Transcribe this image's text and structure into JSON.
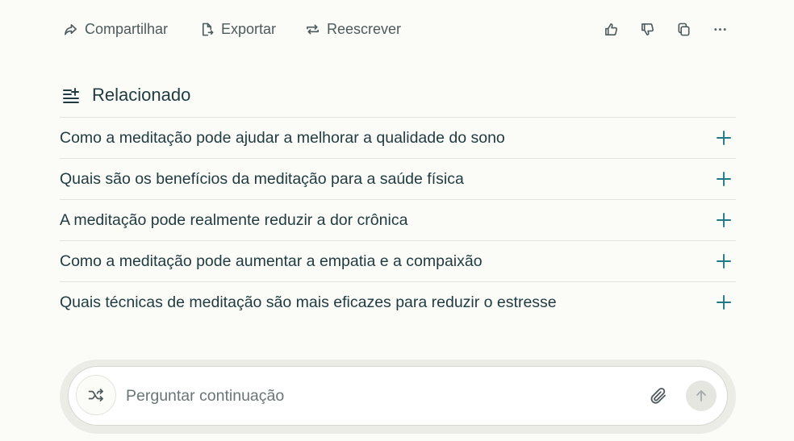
{
  "toolbar": {
    "share_label": "Compartilhar",
    "export_label": "Exportar",
    "rewrite_label": "Reescrever",
    "icons": [
      "share-icon",
      "export-icon",
      "rewrite-icon",
      "thumbs-up-icon",
      "thumbs-down-icon",
      "copy-icon",
      "more-icon"
    ]
  },
  "related": {
    "title": "Relacionado",
    "icon": "related-list-icon",
    "items": [
      {
        "label": "Como a meditação pode ajudar a melhorar a qualidade do sono"
      },
      {
        "label": "Quais são os benefícios da meditação para a saúde física"
      },
      {
        "label": "A meditação pode realmente reduzir a dor crônica"
      },
      {
        "label": "Como a meditação pode aumentar a empatia e a compaixão"
      },
      {
        "label": "Quais técnicas de meditação são mais eficazes para reduzir o estresse"
      }
    ]
  },
  "composer": {
    "placeholder": "Perguntar continuação",
    "value": "",
    "icons": [
      "shuffle-icon",
      "paperclip-icon",
      "arrow-up-icon"
    ]
  },
  "colors": {
    "background": "#fbfbf8",
    "text": "#1f3b40",
    "accent": "#1f7a86",
    "muted": "#4d5a5c"
  }
}
